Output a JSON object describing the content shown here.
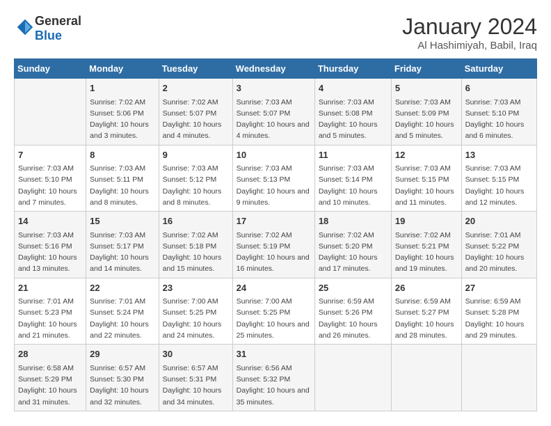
{
  "logo": {
    "general": "General",
    "blue": "Blue"
  },
  "title": "January 2024",
  "location": "Al Hashimiyah, Babil, Iraq",
  "days_header": [
    "Sunday",
    "Monday",
    "Tuesday",
    "Wednesday",
    "Thursday",
    "Friday",
    "Saturday"
  ],
  "weeks": [
    [
      {
        "day": "",
        "sunrise": "",
        "sunset": "",
        "daylight": ""
      },
      {
        "day": "1",
        "sunrise": "Sunrise: 7:02 AM",
        "sunset": "Sunset: 5:06 PM",
        "daylight": "Daylight: 10 hours and 3 minutes."
      },
      {
        "day": "2",
        "sunrise": "Sunrise: 7:02 AM",
        "sunset": "Sunset: 5:07 PM",
        "daylight": "Daylight: 10 hours and 4 minutes."
      },
      {
        "day": "3",
        "sunrise": "Sunrise: 7:03 AM",
        "sunset": "Sunset: 5:07 PM",
        "daylight": "Daylight: 10 hours and 4 minutes."
      },
      {
        "day": "4",
        "sunrise": "Sunrise: 7:03 AM",
        "sunset": "Sunset: 5:08 PM",
        "daylight": "Daylight: 10 hours and 5 minutes."
      },
      {
        "day": "5",
        "sunrise": "Sunrise: 7:03 AM",
        "sunset": "Sunset: 5:09 PM",
        "daylight": "Daylight: 10 hours and 5 minutes."
      },
      {
        "day": "6",
        "sunrise": "Sunrise: 7:03 AM",
        "sunset": "Sunset: 5:10 PM",
        "daylight": "Daylight: 10 hours and 6 minutes."
      }
    ],
    [
      {
        "day": "7",
        "sunrise": "Sunrise: 7:03 AM",
        "sunset": "Sunset: 5:10 PM",
        "daylight": "Daylight: 10 hours and 7 minutes."
      },
      {
        "day": "8",
        "sunrise": "Sunrise: 7:03 AM",
        "sunset": "Sunset: 5:11 PM",
        "daylight": "Daylight: 10 hours and 8 minutes."
      },
      {
        "day": "9",
        "sunrise": "Sunrise: 7:03 AM",
        "sunset": "Sunset: 5:12 PM",
        "daylight": "Daylight: 10 hours and 8 minutes."
      },
      {
        "day": "10",
        "sunrise": "Sunrise: 7:03 AM",
        "sunset": "Sunset: 5:13 PM",
        "daylight": "Daylight: 10 hours and 9 minutes."
      },
      {
        "day": "11",
        "sunrise": "Sunrise: 7:03 AM",
        "sunset": "Sunset: 5:14 PM",
        "daylight": "Daylight: 10 hours and 10 minutes."
      },
      {
        "day": "12",
        "sunrise": "Sunrise: 7:03 AM",
        "sunset": "Sunset: 5:15 PM",
        "daylight": "Daylight: 10 hours and 11 minutes."
      },
      {
        "day": "13",
        "sunrise": "Sunrise: 7:03 AM",
        "sunset": "Sunset: 5:15 PM",
        "daylight": "Daylight: 10 hours and 12 minutes."
      }
    ],
    [
      {
        "day": "14",
        "sunrise": "Sunrise: 7:03 AM",
        "sunset": "Sunset: 5:16 PM",
        "daylight": "Daylight: 10 hours and 13 minutes."
      },
      {
        "day": "15",
        "sunrise": "Sunrise: 7:03 AM",
        "sunset": "Sunset: 5:17 PM",
        "daylight": "Daylight: 10 hours and 14 minutes."
      },
      {
        "day": "16",
        "sunrise": "Sunrise: 7:02 AM",
        "sunset": "Sunset: 5:18 PM",
        "daylight": "Daylight: 10 hours and 15 minutes."
      },
      {
        "day": "17",
        "sunrise": "Sunrise: 7:02 AM",
        "sunset": "Sunset: 5:19 PM",
        "daylight": "Daylight: 10 hours and 16 minutes."
      },
      {
        "day": "18",
        "sunrise": "Sunrise: 7:02 AM",
        "sunset": "Sunset: 5:20 PM",
        "daylight": "Daylight: 10 hours and 17 minutes."
      },
      {
        "day": "19",
        "sunrise": "Sunrise: 7:02 AM",
        "sunset": "Sunset: 5:21 PM",
        "daylight": "Daylight: 10 hours and 19 minutes."
      },
      {
        "day": "20",
        "sunrise": "Sunrise: 7:01 AM",
        "sunset": "Sunset: 5:22 PM",
        "daylight": "Daylight: 10 hours and 20 minutes."
      }
    ],
    [
      {
        "day": "21",
        "sunrise": "Sunrise: 7:01 AM",
        "sunset": "Sunset: 5:23 PM",
        "daylight": "Daylight: 10 hours and 21 minutes."
      },
      {
        "day": "22",
        "sunrise": "Sunrise: 7:01 AM",
        "sunset": "Sunset: 5:24 PM",
        "daylight": "Daylight: 10 hours and 22 minutes."
      },
      {
        "day": "23",
        "sunrise": "Sunrise: 7:00 AM",
        "sunset": "Sunset: 5:25 PM",
        "daylight": "Daylight: 10 hours and 24 minutes."
      },
      {
        "day": "24",
        "sunrise": "Sunrise: 7:00 AM",
        "sunset": "Sunset: 5:25 PM",
        "daylight": "Daylight: 10 hours and 25 minutes."
      },
      {
        "day": "25",
        "sunrise": "Sunrise: 6:59 AM",
        "sunset": "Sunset: 5:26 PM",
        "daylight": "Daylight: 10 hours and 26 minutes."
      },
      {
        "day": "26",
        "sunrise": "Sunrise: 6:59 AM",
        "sunset": "Sunset: 5:27 PM",
        "daylight": "Daylight: 10 hours and 28 minutes."
      },
      {
        "day": "27",
        "sunrise": "Sunrise: 6:59 AM",
        "sunset": "Sunset: 5:28 PM",
        "daylight": "Daylight: 10 hours and 29 minutes."
      }
    ],
    [
      {
        "day": "28",
        "sunrise": "Sunrise: 6:58 AM",
        "sunset": "Sunset: 5:29 PM",
        "daylight": "Daylight: 10 hours and 31 minutes."
      },
      {
        "day": "29",
        "sunrise": "Sunrise: 6:57 AM",
        "sunset": "Sunset: 5:30 PM",
        "daylight": "Daylight: 10 hours and 32 minutes."
      },
      {
        "day": "30",
        "sunrise": "Sunrise: 6:57 AM",
        "sunset": "Sunset: 5:31 PM",
        "daylight": "Daylight: 10 hours and 34 minutes."
      },
      {
        "day": "31",
        "sunrise": "Sunrise: 6:56 AM",
        "sunset": "Sunset: 5:32 PM",
        "daylight": "Daylight: 10 hours and 35 minutes."
      },
      {
        "day": "",
        "sunrise": "",
        "sunset": "",
        "daylight": ""
      },
      {
        "day": "",
        "sunrise": "",
        "sunset": "",
        "daylight": ""
      },
      {
        "day": "",
        "sunrise": "",
        "sunset": "",
        "daylight": ""
      }
    ]
  ]
}
